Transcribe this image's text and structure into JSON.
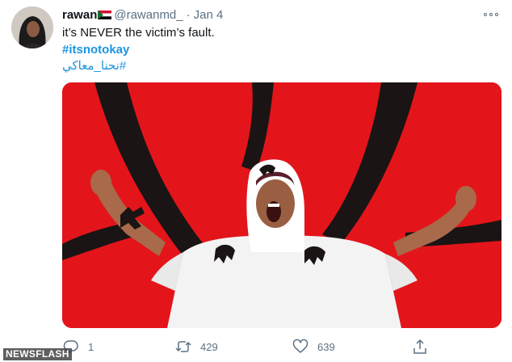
{
  "tweet": {
    "display_name": "rawan",
    "handle": "@rawanmd_",
    "separator": "·",
    "date": "Jan 4",
    "text": "it’s NEVER the victim’s fault.",
    "hashtag_1": "#itsnotokay",
    "hashtag_2": "#نحنا_معاكي"
  },
  "actions": {
    "reply_count": "1",
    "retweet_count": "429",
    "like_count": "639"
  },
  "watermark": "NEWSFLASH",
  "icons": {
    "flag": "sudan-flag-icon",
    "more": "more-options-icon",
    "reply": "reply-icon",
    "retweet": "retweet-icon",
    "like": "heart-icon",
    "share": "share-icon"
  },
  "colors": {
    "link": "#1b95e0",
    "secondary_text": "#5b7083",
    "media_background": "#e3151a"
  }
}
